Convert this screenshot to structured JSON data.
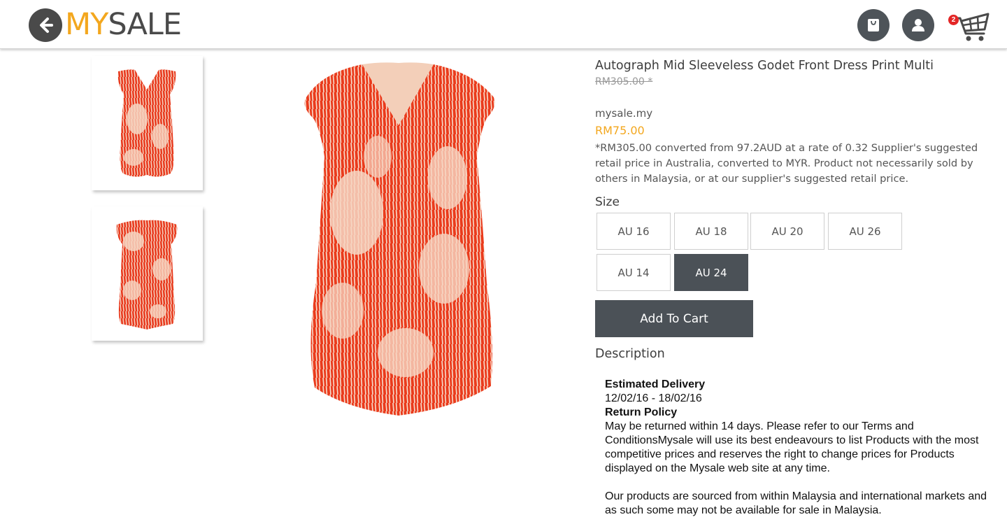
{
  "header": {
    "logo_my": "MY",
    "logo_sale": "SALE",
    "cart_count": "2",
    "icons": [
      "back-arrow-icon",
      "shopping-bag-icon",
      "user-icon",
      "cart-icon"
    ],
    "accent_color": "#f3a71e",
    "dark_color": "#4a4a4a"
  },
  "product": {
    "title": "Autograph Mid Sleeveless Godet Front Dress Print Multi",
    "old_price": "RM305.00 *",
    "seller": "mysale.my",
    "price": "RM75.00",
    "price_note": "*RM305.00 converted from 97.2AUD at a rate of 0.32 Supplier's suggested retail price in Australia, converted to MYR. Product not necessarily sold by others in Malaysia, or at our supplier's suggested retail price.",
    "size_label": "Size",
    "sizes": [
      {
        "label": "AU 16",
        "selected": false
      },
      {
        "label": "AU 18",
        "selected": false
      },
      {
        "label": "AU 20",
        "selected": false
      },
      {
        "label": "AU 26",
        "selected": false
      },
      {
        "label": "AU 14",
        "selected": false
      },
      {
        "label": "AU 24",
        "selected": true
      }
    ],
    "add_to_cart": "Add To Cart",
    "description_heading": "Description",
    "delivery_label": "Estimated Delivery",
    "delivery_dates": "12/02/16 - 18/02/16",
    "return_label": "Return Policy",
    "return_text": "May be returned within 14 days. Please refer to our Terms and ConditionsMysale will use its best endeavours to list Products with the most competitive prices and reserves the right to change prices for Products displayed on the Mysale web site at any time.",
    "sourcing_text": "Our products are sourced from within Malaysia and international markets and as such some may not be available for sale in Malaysia."
  }
}
